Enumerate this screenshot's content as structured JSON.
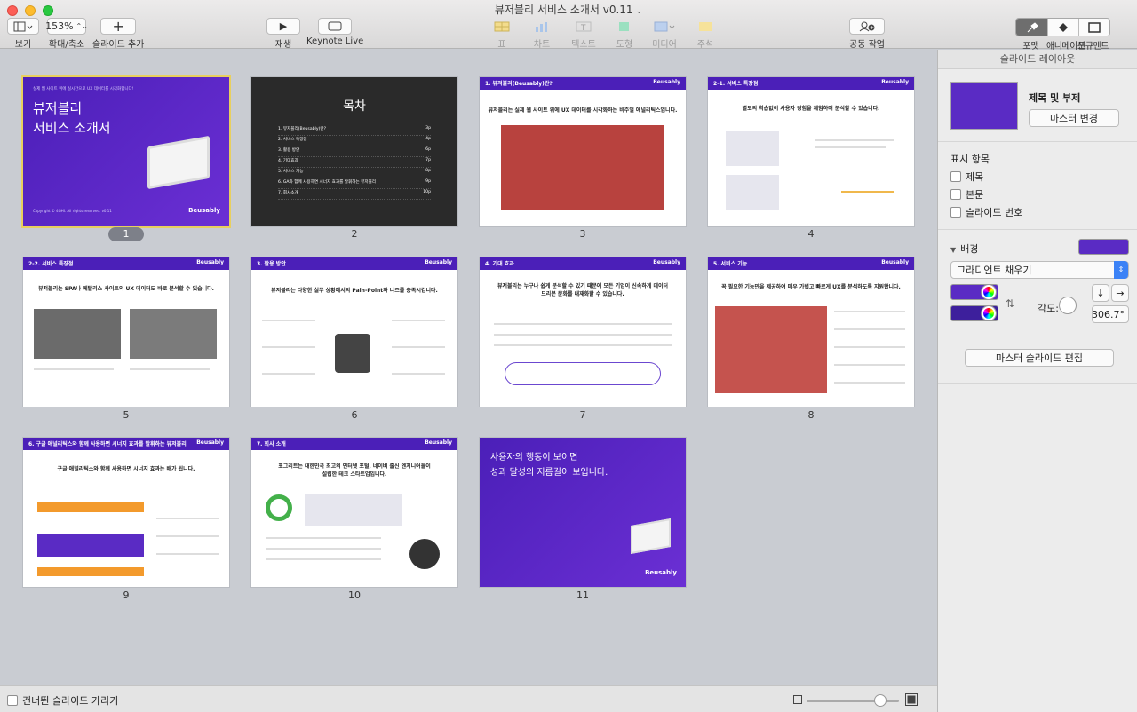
{
  "window": {
    "title": "뷰저블리 서비스 소개서 v0.11"
  },
  "toolbar": {
    "view_label": "보기",
    "zoom_value": "153%",
    "zoom_label": "확대/축소",
    "add_slide_label": "슬라이드 추가",
    "play_label": "재생",
    "keynote_live_label": "Keynote Live",
    "table_label": "표",
    "chart_label": "차트",
    "text_label": "텍스트",
    "shape_label": "도형",
    "media_label": "미디어",
    "comment_label": "주석",
    "collaborate_label": "공동 작업",
    "format_label": "포맷",
    "animate_label": "애니메이션",
    "document_label": "도큐멘트"
  },
  "slides": [
    {
      "num": "1",
      "kind": "cover",
      "small": "실제 웹 사이트 위에 실시간으로 UX 데이터를 시각화합니다!",
      "title1": "뷰저블리",
      "title2": "서비스 소개서",
      "copyright": "Copyright © 4GHI. All rights reserved. v0.11",
      "logo": "Beusably"
    },
    {
      "num": "2",
      "kind": "toc",
      "title": "목차",
      "items": [
        {
          "t": "1. 뷰저블리(Beusably)란?",
          "p": "3p"
        },
        {
          "t": "2. 서비스 특장점",
          "p": "4p"
        },
        {
          "t": "3. 활용 방안",
          "p": "6p"
        },
        {
          "t": "4. 기대효과",
          "p": "7p"
        },
        {
          "t": "5. 서비스 기능",
          "p": "8p"
        },
        {
          "t": "6. GA와 함께 사용하면 시너지 효과를 발휘하는 뷰저블리",
          "p": "9p"
        },
        {
          "t": "7. 회사소개",
          "p": "10p"
        }
      ]
    },
    {
      "num": "3",
      "kind": "content",
      "bar": "1. 뷰저블리(Beusably)란?",
      "heading": "뷰저블리는 실제 웹 사이트 위에 UX 데이터를 시각화하는 비주얼 애널리틱스입니다."
    },
    {
      "num": "4",
      "kind": "content",
      "bar": "2-1. 서비스 특장점",
      "heading": "별도의 학습없이 사용자 경험을 체험하며 분석할 수 있습니다."
    },
    {
      "num": "5",
      "kind": "content",
      "bar": "2-2. 서비스 특장점",
      "heading": "뷰저블리는 SPA나 페탈리스 사이트의 UX 데이터도 바로 분석할 수 있습니다."
    },
    {
      "num": "6",
      "kind": "content",
      "bar": "3. 활용 방안",
      "heading": "뷰저블리는 다양한 실무 상황에서의 Pain-Point와 니즈를 충족시킵니다."
    },
    {
      "num": "7",
      "kind": "content",
      "bar": "4. 기대 효과",
      "heading": "뷰저블리는 누구나 쉽게 분석할 수 있기 때문에 모든 기업이 신속하게 데이터 드리븐 문화를 내재화할 수 있습니다."
    },
    {
      "num": "8",
      "kind": "content",
      "bar": "5. 서비스 기능",
      "heading": "꼭 필요한 기능만을 제공하여 매우 가볍고 빠르게 UX를 분석하도록 지원합니다."
    },
    {
      "num": "9",
      "kind": "content",
      "bar": "6. 구글 애널리틱스와 함께 사용하면 시너지 효과를 발휘하는 뷰저블리",
      "heading": "구글 애널리틱스와 함께 사용하면 시너지 효과는 배가 됩니다."
    },
    {
      "num": "10",
      "kind": "content",
      "bar": "7. 회사 소개",
      "heading": "포그리트는 대한민국 최고의 인터넷 포털, 네이버 출신 엔지니어들이 설립한 테크 스타트업입니다."
    },
    {
      "num": "11",
      "kind": "closing",
      "line1": "사용자의 행동이 보이면",
      "line2": "성과 달성의 지름길이 보입니다.",
      "logo": "Beusably"
    }
  ],
  "sidebar": {
    "header": "슬라이드 레이아웃",
    "layout_name": "제목 및 부제",
    "master_change": "마스터 변경",
    "show_items": "표시 항목",
    "check_title": "제목",
    "check_body": "본문",
    "check_number": "슬라이드 번호",
    "background": "배경",
    "fill_type": "그라디언트 채우기",
    "angle_label": "각도:",
    "angle_value": "306.7°",
    "edit_master": "마스터 슬라이드 편집",
    "colors": {
      "fill": "#5a2bc4",
      "grad1": "#5a2bc4",
      "grad2": "#3d1f9c"
    }
  },
  "bottom": {
    "skip_label": "건너뛴 슬라이드 가리기"
  }
}
